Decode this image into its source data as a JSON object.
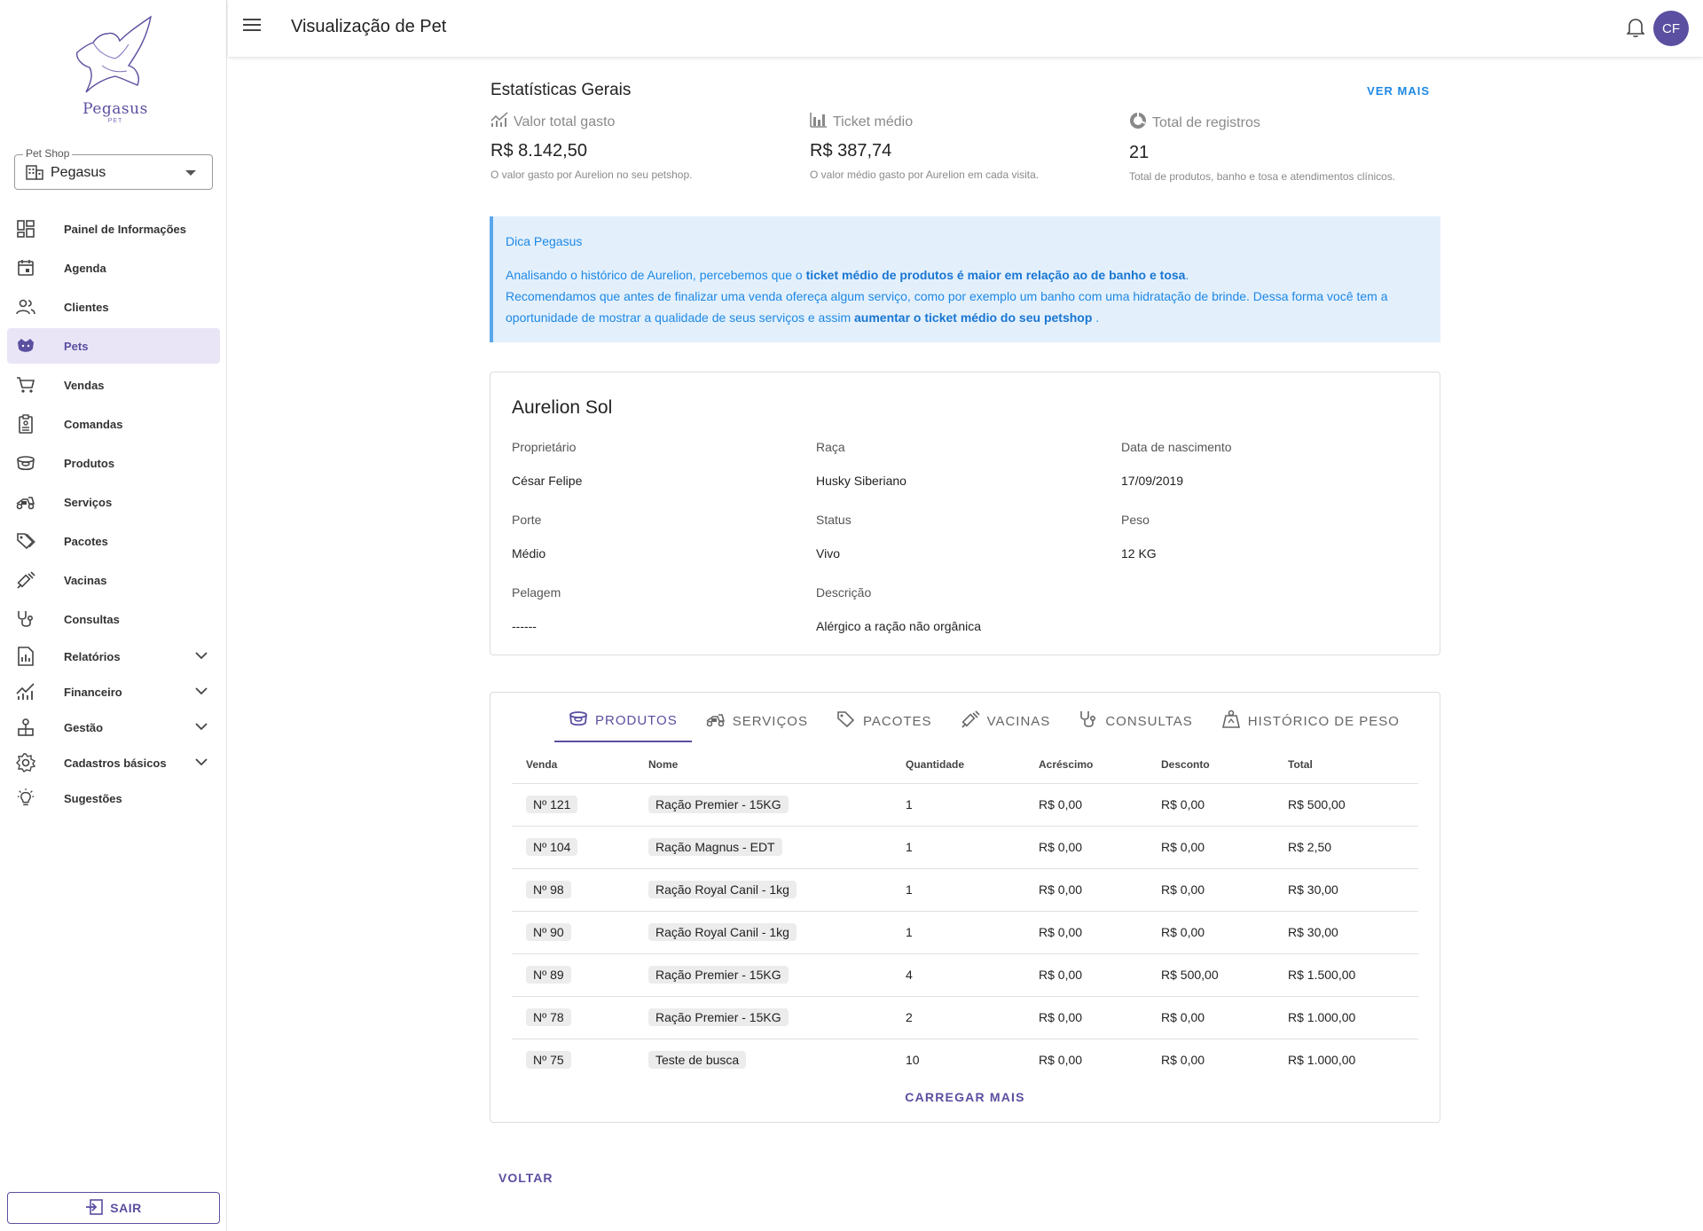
{
  "brand": {
    "name": "Pegasus",
    "sub": "PET"
  },
  "shop_select": {
    "legend": "Pet Shop",
    "value": "Pegasus"
  },
  "sidebar": {
    "items": [
      {
        "label": "Painel de Informações",
        "icon": "dashboard-icon"
      },
      {
        "label": "Agenda",
        "icon": "calendar-icon"
      },
      {
        "label": "Clientes",
        "icon": "people-icon"
      },
      {
        "label": "Pets",
        "icon": "paw-icon",
        "active": true
      },
      {
        "label": "Vendas",
        "icon": "cart-icon"
      },
      {
        "label": "Comandas",
        "icon": "clipboard-icon"
      },
      {
        "label": "Produtos",
        "icon": "bowl-icon"
      },
      {
        "label": "Serviços",
        "icon": "scooter-icon"
      },
      {
        "label": "Pacotes",
        "icon": "tag-icon"
      },
      {
        "label": "Vacinas",
        "icon": "syringe-icon"
      },
      {
        "label": "Consultas",
        "icon": "stethoscope-icon"
      },
      {
        "label": "Relatórios",
        "icon": "report-icon",
        "expandable": true
      },
      {
        "label": "Financeiro",
        "icon": "finance-icon",
        "expandable": true
      },
      {
        "label": "Gestão",
        "icon": "org-icon",
        "expandable": true
      },
      {
        "label": "Cadastros básicos",
        "icon": "gear-icon",
        "expandable": true
      },
      {
        "label": "Sugestões",
        "icon": "lightbulb-icon"
      }
    ],
    "logout_label": "SAIR"
  },
  "topbar": {
    "title": "Visualização de Pet",
    "avatar": "CF"
  },
  "stats": {
    "title": "Estatísticas Gerais",
    "see_more": "VER MAIS",
    "items": [
      {
        "label": "Valor total gasto",
        "value": "R$ 8.142,50",
        "desc": "O valor gasto por Aurelion no seu petshop.",
        "icon": "chart-icon"
      },
      {
        "label": "Ticket médio",
        "value": "R$ 387,74",
        "desc": "O valor médio gasto por Aurelion em cada visita.",
        "icon": "bar-chart-icon"
      },
      {
        "label": "Total de registros",
        "value": "21",
        "desc": "Total de produtos, banho e tosa e atendimentos clínicos.",
        "icon": "donut-icon"
      }
    ]
  },
  "tip": {
    "title": "Dica Pegasus",
    "line1_a": "Analisando o histórico de Aurelion, percebemos que o ",
    "line1_b": "ticket médio de produtos é maior em relação ao de banho e tosa",
    "line1_c": ".",
    "line2_a": "Recomendamos que antes de finalizar uma venda ofereça algum serviço, como por exemplo um banho com uma hidratação de brinde. Dessa forma você tem a oportunidade de mostrar a qualidade de seus serviços e assim ",
    "line2_b": "aumentar o ticket médio do seu petshop",
    "line2_c": " ."
  },
  "pet": {
    "name": "Aurelion Sol",
    "fields": [
      {
        "label": "Proprietário",
        "value": "César Felipe"
      },
      {
        "label": "Raça",
        "value": "Husky Siberiano"
      },
      {
        "label": "Data de nascimento",
        "value": "17/09/2019"
      },
      {
        "label": "Porte",
        "value": "Médio"
      },
      {
        "label": "Status",
        "value": "Vivo"
      },
      {
        "label": "Peso",
        "value": "12 KG"
      },
      {
        "label": "Pelagem",
        "value": "------"
      },
      {
        "label": "Descrição",
        "value": "Alérgico a ração não orgânica"
      }
    ]
  },
  "tabs": [
    {
      "label": "PRODUTOS",
      "icon": "bowl-icon",
      "active": true
    },
    {
      "label": "SERVIÇOS",
      "icon": "scooter-icon"
    },
    {
      "label": "PACOTES",
      "icon": "tag-icon"
    },
    {
      "label": "VACINAS",
      "icon": "syringe-icon"
    },
    {
      "label": "CONSULTAS",
      "icon": "stethoscope-icon"
    },
    {
      "label": "HISTÓRICO DE PESO",
      "icon": "weight-icon"
    }
  ],
  "table": {
    "headers": [
      "Venda",
      "Nome",
      "Quantidade",
      "Acréscimo",
      "Desconto",
      "Total"
    ],
    "rows": [
      [
        "Nº 121",
        "Ração Premier - 15KG",
        "1",
        "R$ 0,00",
        "R$ 0,00",
        "R$ 500,00"
      ],
      [
        "Nº 104",
        "Ração Magnus - EDT",
        "1",
        "R$ 0,00",
        "R$ 0,00",
        "R$ 2,50"
      ],
      [
        "Nº 98",
        "Ração Royal Canil - 1kg",
        "1",
        "R$ 0,00",
        "R$ 0,00",
        "R$ 30,00"
      ],
      [
        "Nº 90",
        "Ração Royal Canil - 1kg",
        "1",
        "R$ 0,00",
        "R$ 0,00",
        "R$ 30,00"
      ],
      [
        "Nº 89",
        "Ração Premier - 15KG",
        "4",
        "R$ 0,00",
        "R$ 500,00",
        "R$ 1.500,00"
      ],
      [
        "Nº 78",
        "Ração Premier - 15KG",
        "2",
        "R$ 0,00",
        "R$ 0,00",
        "R$ 1.000,00"
      ],
      [
        "Nº 75",
        "Teste de busca",
        "10",
        "R$ 0,00",
        "R$ 0,00",
        "R$ 1.000,00"
      ]
    ],
    "load_more": "CARREGAR MAIS"
  },
  "back_label": "VOLTAR",
  "colors": {
    "primary": "#5a4fa0",
    "tip_text": "#1e88e5",
    "tip_bg": "#e3f0fc"
  }
}
